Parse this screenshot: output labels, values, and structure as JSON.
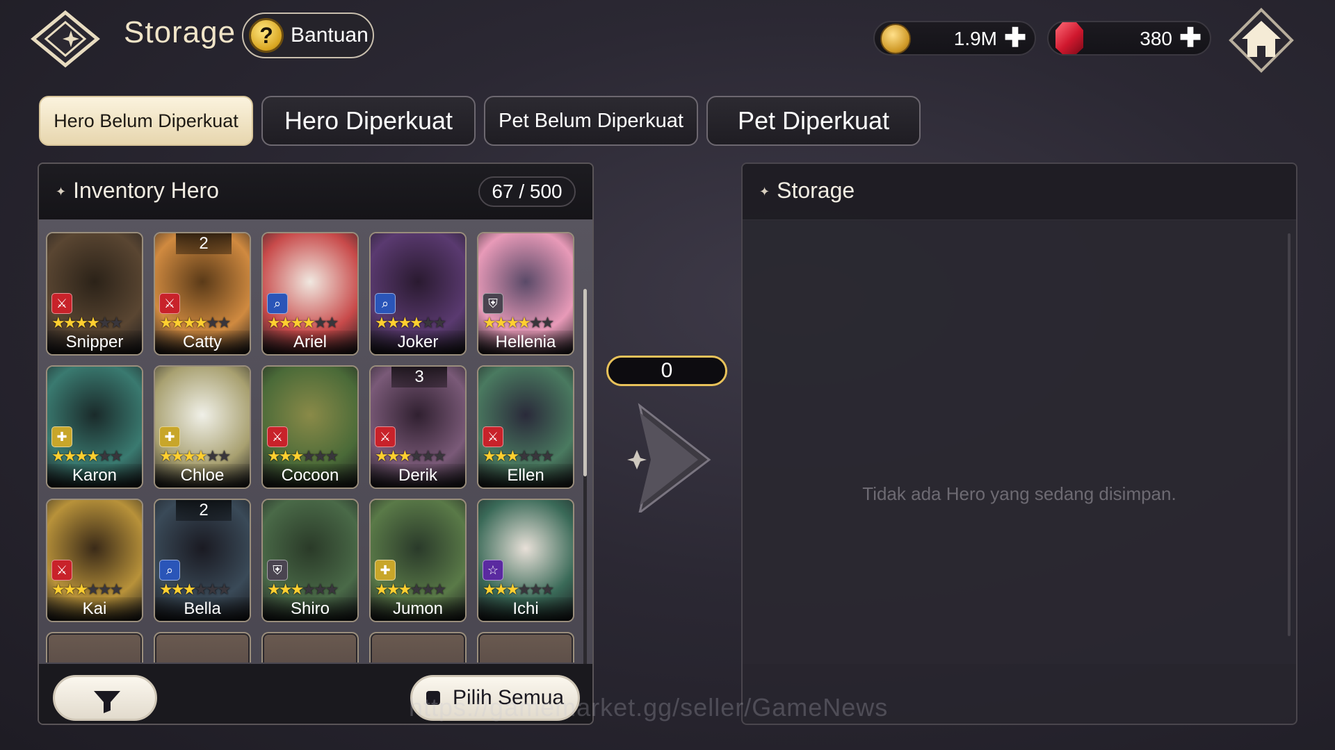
{
  "header": {
    "title": "Storage",
    "help_label": "Bantuan",
    "help_icon": "question-icon",
    "gold": "1.9M",
    "gems": "380",
    "plus": "✚"
  },
  "tabs": [
    {
      "label": "Hero Belum Diperkuat",
      "active": true
    },
    {
      "label": "Hero Diperkuat",
      "active": false
    },
    {
      "label": "Pet Belum Diperkuat",
      "active": false
    },
    {
      "label": "Pet Diperkuat",
      "active": false
    }
  ],
  "inventory": {
    "title": "Inventory Hero",
    "count": "67 / 500",
    "heroes": [
      {
        "name": "Snipper",
        "stars": 4,
        "class": "sword",
        "badge": ""
      },
      {
        "name": "Catty",
        "stars": 4,
        "class": "sword",
        "badge": "2"
      },
      {
        "name": "Ariel",
        "stars": 4,
        "class": "magnifier",
        "badge": ""
      },
      {
        "name": "Joker",
        "stars": 4,
        "class": "magnifier",
        "badge": ""
      },
      {
        "name": "Hellenia",
        "stars": 4,
        "class": "shield",
        "badge": ""
      },
      {
        "name": "Karon",
        "stars": 4,
        "class": "cross",
        "badge": ""
      },
      {
        "name": "Chloe",
        "stars": 4,
        "class": "cross",
        "badge": ""
      },
      {
        "name": "Cocoon",
        "stars": 3,
        "class": "sword",
        "badge": ""
      },
      {
        "name": "Derik",
        "stars": 3,
        "class": "sword",
        "badge": "3"
      },
      {
        "name": "Ellen",
        "stars": 3,
        "class": "sword",
        "badge": ""
      },
      {
        "name": "Kai",
        "stars": 3,
        "class": "sword",
        "badge": ""
      },
      {
        "name": "Bella",
        "stars": 3,
        "class": "magnifier",
        "badge": "2"
      },
      {
        "name": "Shiro",
        "stars": 3,
        "class": "shield",
        "badge": ""
      },
      {
        "name": "Jumon",
        "stars": 3,
        "class": "cross",
        "badge": ""
      },
      {
        "name": "Ichi",
        "stars": 3,
        "class": "star",
        "badge": ""
      }
    ],
    "select_all_label": "Pilih Semua"
  },
  "transfer": {
    "count": "0"
  },
  "storage": {
    "title": "Storage",
    "empty_message": "Tidak ada Hero yang sedang disimpan."
  },
  "watermark": "https://gamemarket.gg/seller/GameNews",
  "colors": {
    "sword": "#c8222a",
    "magnifier": "#2a55b8",
    "shield": "#4a4450",
    "cross": "#c8a62a",
    "star": "#5a2aa0"
  }
}
